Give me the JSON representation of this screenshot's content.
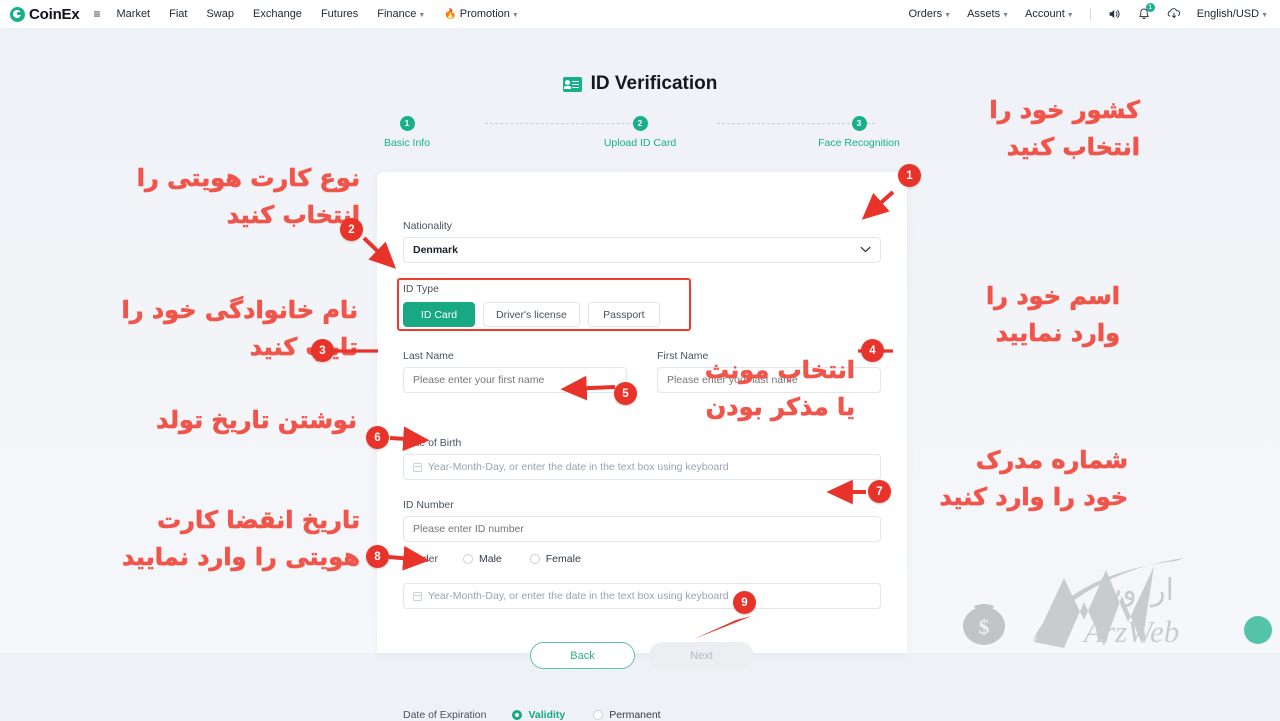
{
  "nav": {
    "brand": "CoinEx",
    "menu_icon": "hamburger-icon",
    "links": [
      {
        "label": "Market",
        "caret": false
      },
      {
        "label": "Fiat",
        "caret": false
      },
      {
        "label": "Swap",
        "caret": false
      },
      {
        "label": "Exchange",
        "caret": false
      },
      {
        "label": "Futures",
        "caret": false
      },
      {
        "label": "Finance",
        "caret": true
      },
      {
        "label": "Promotion",
        "caret": true,
        "fire": true
      }
    ],
    "right_links": [
      {
        "label": "Orders",
        "caret": true
      },
      {
        "label": "Assets",
        "caret": true
      },
      {
        "label": "Account",
        "caret": true
      }
    ],
    "icons": [
      "sound-icon",
      "notification-icon",
      "download-icon"
    ],
    "notification_count": "1",
    "language": "English/USD"
  },
  "header": {
    "title": "ID Verification",
    "title_icon": "id-card-icon"
  },
  "steps": [
    {
      "num": "1",
      "label": "Basic Info"
    },
    {
      "num": "2",
      "label": "Upload ID Card"
    },
    {
      "num": "3",
      "label": "Face Recognition"
    }
  ],
  "form": {
    "nationality": {
      "label": "Nationality",
      "value": "Denmark",
      "chevron": "chevron-down-icon"
    },
    "id_type": {
      "label": "ID Type",
      "options": [
        "ID Card",
        "Driver's license",
        "Passport"
      ],
      "selected": "ID Card"
    },
    "last_name": {
      "label": "Last Name",
      "value": "",
      "placeholder": "Please enter your first name"
    },
    "first_name": {
      "label": "First Name",
      "value": "",
      "placeholder": "Please enter your last name"
    },
    "gender": {
      "label": "Gender",
      "options": [
        "Male",
        "Female"
      ],
      "selected": ""
    },
    "date_of_birth": {
      "label": "Date of Birth",
      "value": "",
      "placeholder": "Year-Month-Day, or enter the date in the text box using keyboard"
    },
    "id_number": {
      "label": "ID Number",
      "value": "",
      "placeholder": "Please enter ID number"
    },
    "date_of_expiration": {
      "label": "Date of Expiration",
      "options": [
        "Validity",
        "Permanent"
      ],
      "selected": "Validity",
      "value": "",
      "placeholder": "Year-Month-Day, or enter the date in the text box using keyboard"
    },
    "buttons": {
      "back": "Back",
      "next": "Next"
    }
  },
  "annotations": [
    {
      "num": "1",
      "text": "کشور خود را\nانتخاب کنید"
    },
    {
      "num": "2",
      "text": "نوع کارت هویتی را\nانتخاب کنید"
    },
    {
      "num": "3",
      "text": "نام خانوادگی خود را\nتایپ کنید"
    },
    {
      "num": "4",
      "text": "اسم خود را\nوارد نمایید"
    },
    {
      "num": "5",
      "text": "انتخاب مونث\nیا مذکر بودن"
    },
    {
      "num": "6",
      "text": "نوشتن تاریخ تولد"
    },
    {
      "num": "7",
      "text": "شماره مدرک\nخود را وارد کنید"
    },
    {
      "num": "8",
      "text": "تاریخ انقضا کارت\nهویتی را وارد نمایید"
    },
    {
      "num": "9",
      "text": ""
    }
  ],
  "watermark": {
    "latin": "ArzWeb",
    "persian": "ارزوب"
  },
  "colors": {
    "accent": "#17a884",
    "annotation": "#f0554b",
    "bubble": "#e8332a",
    "page_bg": "#eef1f6"
  }
}
